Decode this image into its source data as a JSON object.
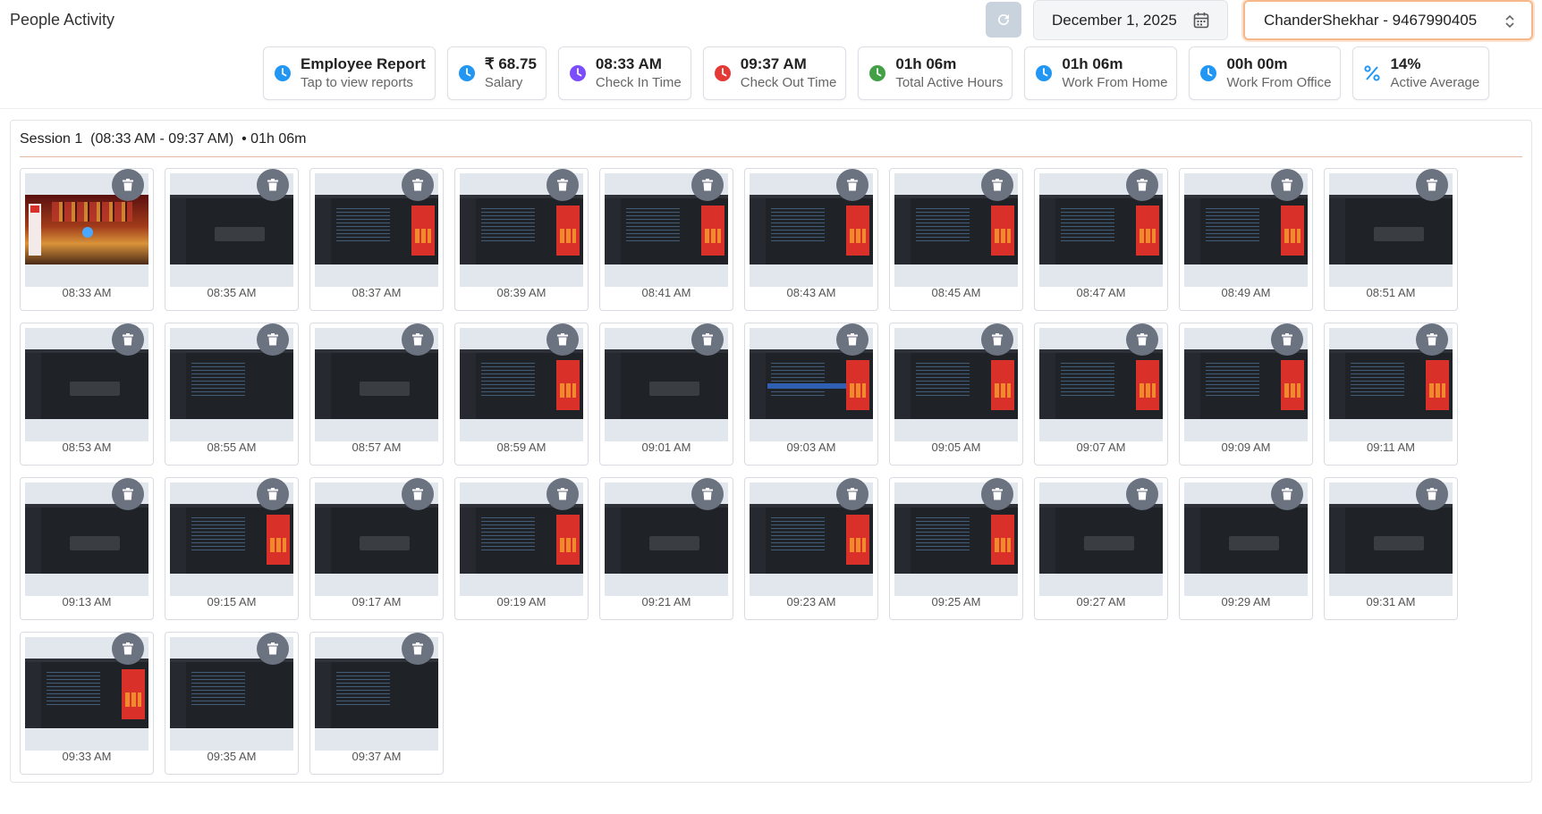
{
  "header": {
    "title": "People Activity",
    "date": "December 1, 2025",
    "user": "ChanderShekhar - 9467990405"
  },
  "colors": {
    "accent_blue": "#2196f3",
    "purple": "#7c4dff",
    "red": "#e53935",
    "green": "#43a047",
    "select_border": "#f5b88b"
  },
  "stats": [
    {
      "value": "Employee Report",
      "label": "Tap to view reports",
      "icon": "clock-icon",
      "color": "#2196f3"
    },
    {
      "value": "₹ 68.75",
      "label": "Salary",
      "icon": "clock-icon",
      "color": "#2196f3"
    },
    {
      "value": "08:33 AM",
      "label": "Check In Time",
      "icon": "clock-icon",
      "color": "#7c4dff"
    },
    {
      "value": "09:37 AM",
      "label": "Check Out Time",
      "icon": "clock-icon",
      "color": "#e53935"
    },
    {
      "value": "01h 06m",
      "label": "Total Active Hours",
      "icon": "clock-icon",
      "color": "#43a047"
    },
    {
      "value": "01h 06m",
      "label": "Work From Home",
      "icon": "clock-icon",
      "color": "#2196f3"
    },
    {
      "value": "00h 00m",
      "label": "Work From Office",
      "icon": "clock-icon",
      "color": "#2196f3"
    },
    {
      "value": "14%",
      "label": "Active Average",
      "icon": "percent-icon",
      "color": "#2196f3"
    }
  ],
  "session": {
    "title": "Session 1",
    "range": "(08:33 AM - 09:37 AM)",
    "duration": "• 01h 06m"
  },
  "screenshots": [
    {
      "time": "08:33 AM",
      "kind": "room"
    },
    {
      "time": "08:35 AM",
      "kind": "dialog"
    },
    {
      "time": "08:37 AM",
      "kind": "code-red"
    },
    {
      "time": "08:39 AM",
      "kind": "code-red"
    },
    {
      "time": "08:41 AM",
      "kind": "code-red"
    },
    {
      "time": "08:43 AM",
      "kind": "code-red"
    },
    {
      "time": "08:45 AM",
      "kind": "code-red"
    },
    {
      "time": "08:47 AM",
      "kind": "code-red"
    },
    {
      "time": "08:49 AM",
      "kind": "code-red"
    },
    {
      "time": "08:51 AM",
      "kind": "dialog"
    },
    {
      "time": "08:53 AM",
      "kind": "dialog"
    },
    {
      "time": "08:55 AM",
      "kind": "code"
    },
    {
      "time": "08:57 AM",
      "kind": "dialog"
    },
    {
      "time": "08:59 AM",
      "kind": "code-red"
    },
    {
      "time": "09:01 AM",
      "kind": "dialog"
    },
    {
      "time": "09:03 AM",
      "kind": "highlight"
    },
    {
      "time": "09:05 AM",
      "kind": "code-red"
    },
    {
      "time": "09:07 AM",
      "kind": "code-red"
    },
    {
      "time": "09:09 AM",
      "kind": "code-red"
    },
    {
      "time": "09:11 AM",
      "kind": "code-red"
    },
    {
      "time": "09:13 AM",
      "kind": "dialog"
    },
    {
      "time": "09:15 AM",
      "kind": "code-red"
    },
    {
      "time": "09:17 AM",
      "kind": "dialog"
    },
    {
      "time": "09:19 AM",
      "kind": "code-red"
    },
    {
      "time": "09:21 AM",
      "kind": "dialog"
    },
    {
      "time": "09:23 AM",
      "kind": "code-red"
    },
    {
      "time": "09:25 AM",
      "kind": "code-red"
    },
    {
      "time": "09:27 AM",
      "kind": "dialog"
    },
    {
      "time": "09:29 AM",
      "kind": "dialog"
    },
    {
      "time": "09:31 AM",
      "kind": "dialog"
    },
    {
      "time": "09:33 AM",
      "kind": "code-red"
    },
    {
      "time": "09:35 AM",
      "kind": "code"
    },
    {
      "time": "09:37 AM",
      "kind": "code"
    }
  ]
}
